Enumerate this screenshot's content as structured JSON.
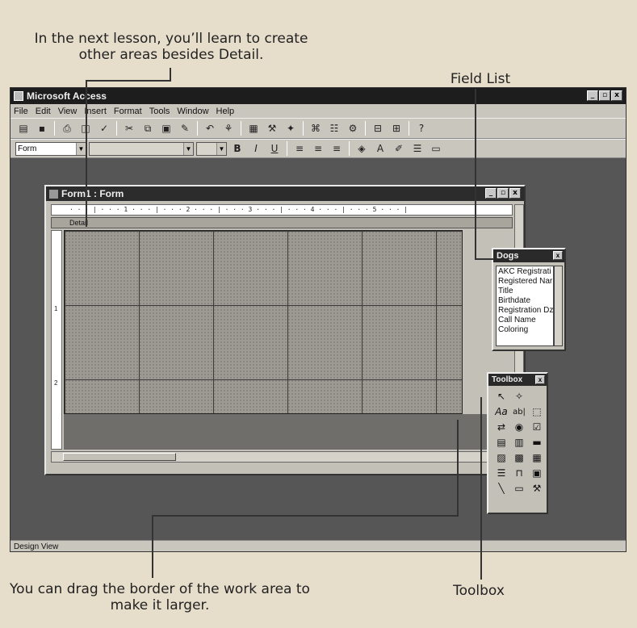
{
  "callouts": {
    "top_left": "In the next lesson, you’ll learn to create other areas besides Detail.",
    "top_right": "Field List",
    "bottom_left": "You can drag the border of the work area to make it larger.",
    "bottom_right": "Toolbox"
  },
  "app": {
    "title": "Microsoft Access",
    "window_buttons": [
      "_",
      "▫",
      "x"
    ]
  },
  "menu": [
    "File",
    "Edit",
    "View",
    "Insert",
    "Format",
    "Tools",
    "Window",
    "Help"
  ],
  "toolbar2": {
    "object_combo": "Form",
    "font_combo": "",
    "size_combo": ""
  },
  "form_window": {
    "title": "Form1 : Form",
    "ruler_marks": "· · · | · · · 1 · · · | · · · 2 · · · | · · · 3 · · · | · · · 4 · · · | · · · 5 · · · |",
    "section_label": "Detail",
    "vruler_marks": [
      "1",
      "2"
    ]
  },
  "field_list": {
    "title": "Dogs",
    "items": [
      "AKC Registrati",
      "Registered Nar",
      "Title",
      "Birthdate",
      "Registration Dz",
      "Call Name",
      "Coloring"
    ]
  },
  "toolbox": {
    "title": "Toolbox",
    "tools": [
      "pointer-icon",
      "wizard-icon",
      "label-tool-icon",
      "textbox-tool-icon",
      "option-group-icon",
      "toggle-button-icon",
      "option-button-icon",
      "checkbox-icon",
      "combobox-icon",
      "listbox-icon",
      "command-button-icon",
      "image-icon",
      "unbound-object-icon",
      "bound-object-icon",
      "page-break-icon",
      "tab-control-icon",
      "subform-icon",
      "line-icon",
      "rectangle-icon",
      "more-controls-icon"
    ]
  },
  "status": {
    "text": "Design View"
  }
}
